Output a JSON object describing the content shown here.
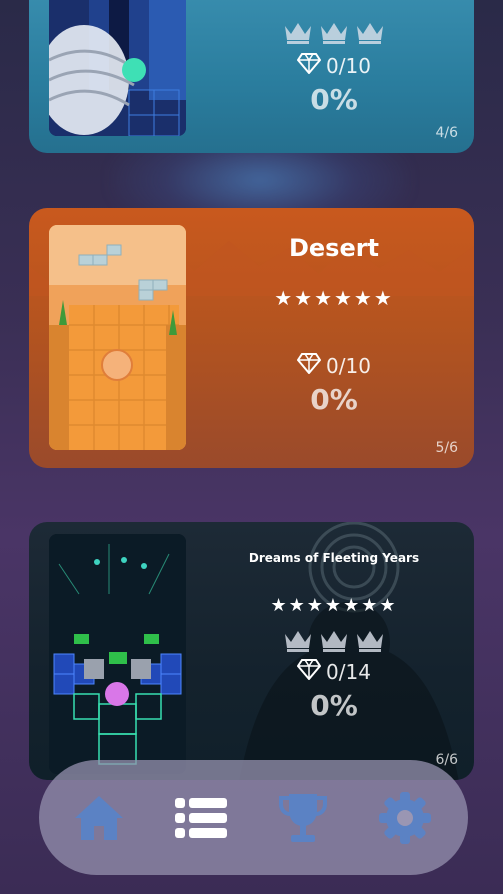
{
  "levels": [
    {
      "title": "",
      "stars": "",
      "crowns": [
        "crown-icon",
        "crown-icon",
        "crown-icon"
      ],
      "gems": "0/10",
      "percent": "0%",
      "count": "4/6",
      "color": "#2a7d9e"
    },
    {
      "title": "Desert",
      "stars": "★★★★★★",
      "gems": "0/10",
      "percent": "0%",
      "count": "5/6",
      "color": "#b4541f"
    },
    {
      "title": "Dreams of Fleeting Years",
      "stars": "★★★★★★★",
      "crowns": [
        "crown-icon",
        "crown-icon",
        "crown-icon"
      ],
      "gems": "0/14",
      "percent": "0%",
      "count": "6/6",
      "color": "#14222d"
    }
  ],
  "nav": {
    "items": [
      "home-icon",
      "level-list-icon",
      "trophy-icon",
      "settings-icon"
    ],
    "icon_color": "#5b82c4"
  }
}
